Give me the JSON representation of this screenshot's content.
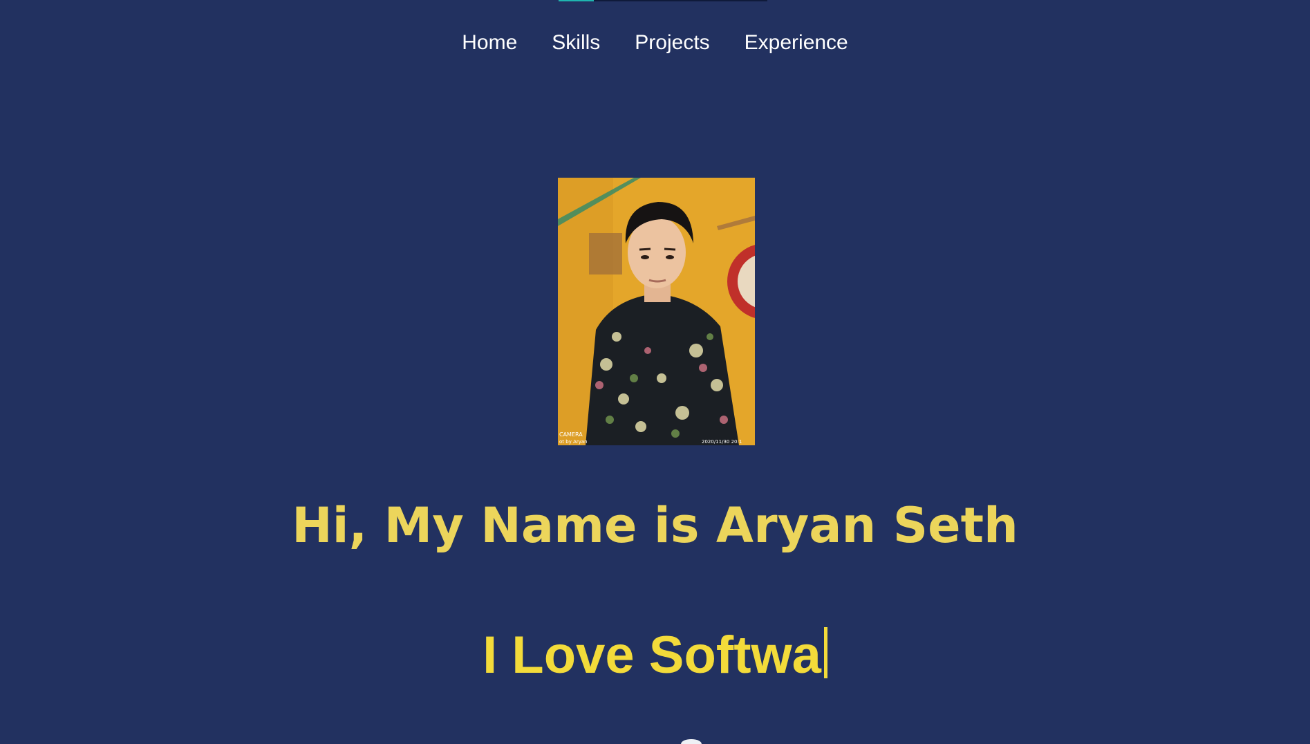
{
  "nav": {
    "items": [
      {
        "label": "Home"
      },
      {
        "label": "Skills"
      },
      {
        "label": "Projects"
      },
      {
        "label": "Experience"
      }
    ]
  },
  "scroll_progress": 0.17,
  "profile": {
    "photo_caption_left_1": "CAMERA",
    "photo_caption_left_2": "ot by Aryan",
    "photo_caption_right": "2020/11/30 20:1"
  },
  "hero": {
    "headline": "Hi, My Name is Aryan Seth",
    "typed_text": "I Love Softwa"
  },
  "colors": {
    "background": "#223160",
    "headline": "#ecd55b",
    "typed": "#f3db3a",
    "progress": "#1fb5b0"
  }
}
